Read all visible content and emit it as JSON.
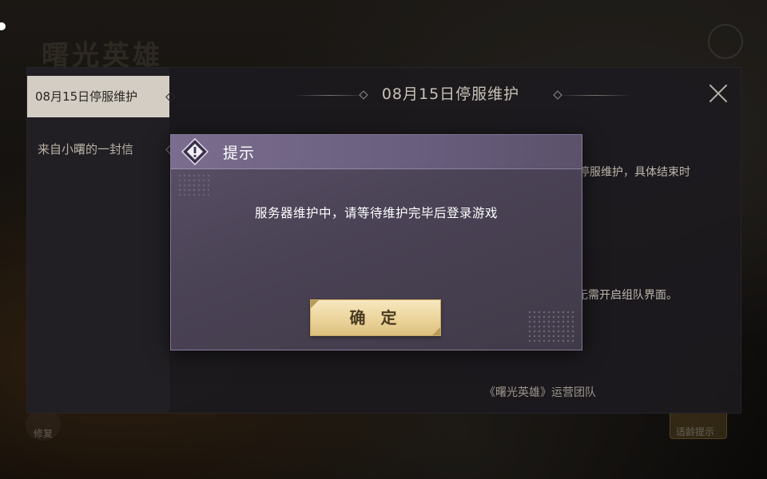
{
  "background": {
    "logo_text": "曙光英雄",
    "bottom_left_label": "修复",
    "bottom_right_label": "适龄提示"
  },
  "notice": {
    "sidebar": {
      "items": [
        {
          "label": "08月15日停服维护",
          "active": true
        },
        {
          "label": "来自小曙的一封信",
          "active": false
        }
      ]
    },
    "title": "08月15日停服维护",
    "body_line_1": "停服维护，具体结束时",
    "body_line_2": "无需开启组队界面。",
    "signature": "《曙光英雄》运营团队"
  },
  "modal": {
    "title": "提示",
    "message": "服务器维护中，请等待维护完毕后登录游戏",
    "confirm_label": "确 定",
    "icon": "warning-diamond-icon"
  },
  "colors": {
    "modal_bg": "#4b4356",
    "modal_header": "#6b5f80",
    "confirm_bg": "#ecd49a",
    "confirm_text": "#4a3b22",
    "sidebar_active_bg": "#d3cdc4"
  }
}
